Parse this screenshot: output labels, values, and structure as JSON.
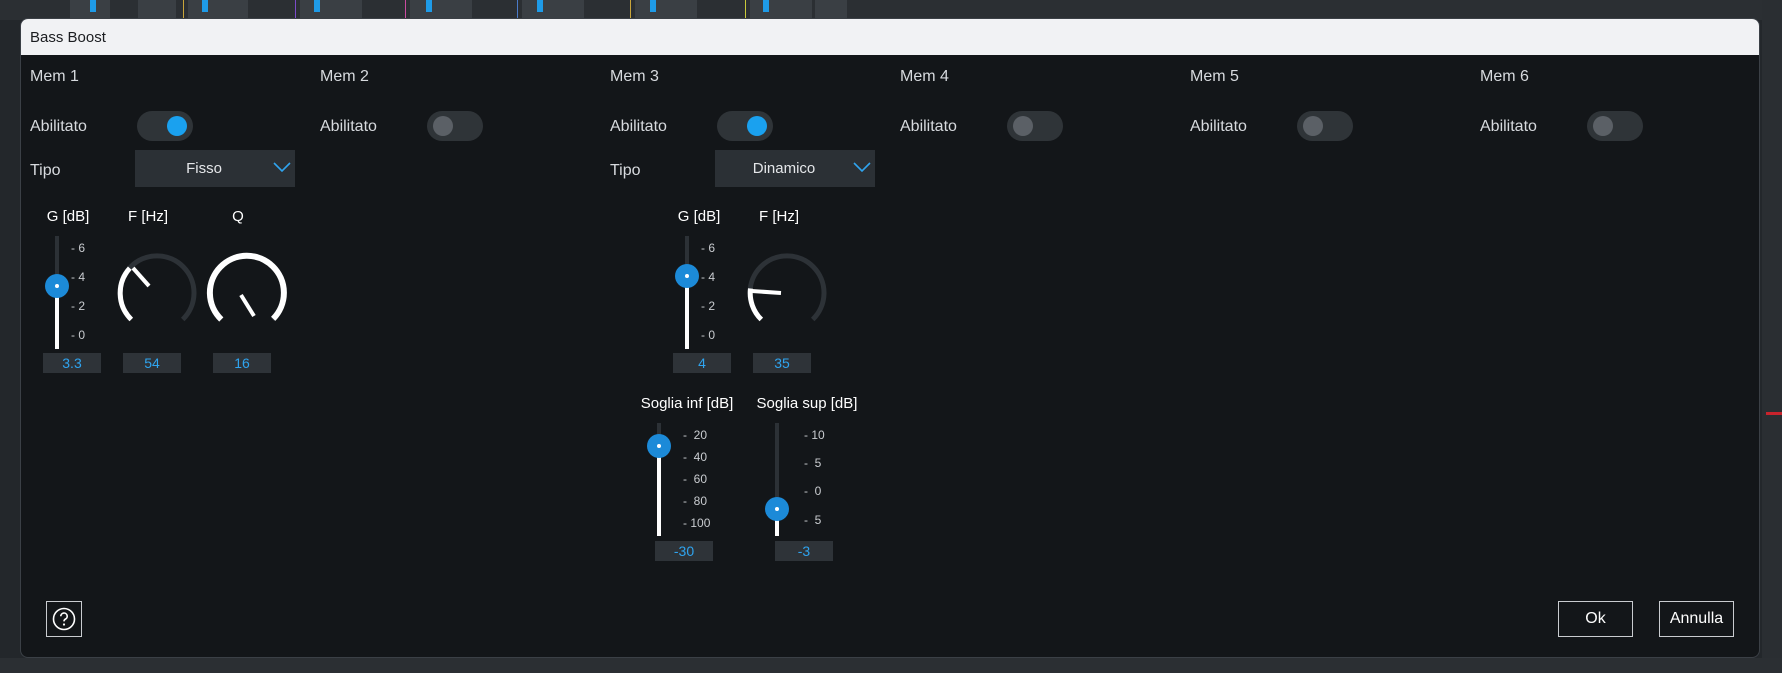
{
  "dialog": {
    "title": "Bass Boost"
  },
  "common": {
    "enabled_label": "Abilitato",
    "type_label": "Tipo"
  },
  "mems": [
    {
      "title": "Mem 1",
      "enabled": true,
      "type": "Fisso"
    },
    {
      "title": "Mem 2",
      "enabled": false
    },
    {
      "title": "Mem 3",
      "enabled": true,
      "type": "Dinamico"
    },
    {
      "title": "Mem 4",
      "enabled": false
    },
    {
      "title": "Mem 5",
      "enabled": false
    },
    {
      "title": "Mem 6",
      "enabled": false
    }
  ],
  "mem1": {
    "gain": {
      "label": "G [dB]",
      "value": "3.3",
      "ticks": [
        "6",
        "4",
        "2",
        "0"
      ]
    },
    "freq": {
      "label": "F [Hz]",
      "value": "54"
    },
    "q": {
      "label": "Q",
      "value": "16"
    }
  },
  "mem3": {
    "gain": {
      "label": "G [dB]",
      "value": "4",
      "ticks": [
        "6",
        "4",
        "2",
        "0"
      ]
    },
    "freq": {
      "label": "F [Hz]",
      "value": "35"
    },
    "low_threshold": {
      "label": "Soglia inf [dB]",
      "value": "-30",
      "ticks": [
        "20",
        "40",
        "60",
        "80",
        "100"
      ]
    },
    "high_threshold": {
      "label": "Soglia sup [dB]",
      "value": "-3",
      "ticks": [
        "10",
        "5",
        "0",
        "5"
      ]
    }
  },
  "footer": {
    "ok_label": "Ok",
    "cancel_label": "Annulla"
  },
  "colors": {
    "accent": "#1aa1ef",
    "value_text": "#2fa4ef",
    "dialog_bg": "#131619",
    "titlebar_bg": "#f1f2f4"
  },
  "icons": {
    "help": "question-circle-icon",
    "dropdown": "chevron-down-icon"
  }
}
